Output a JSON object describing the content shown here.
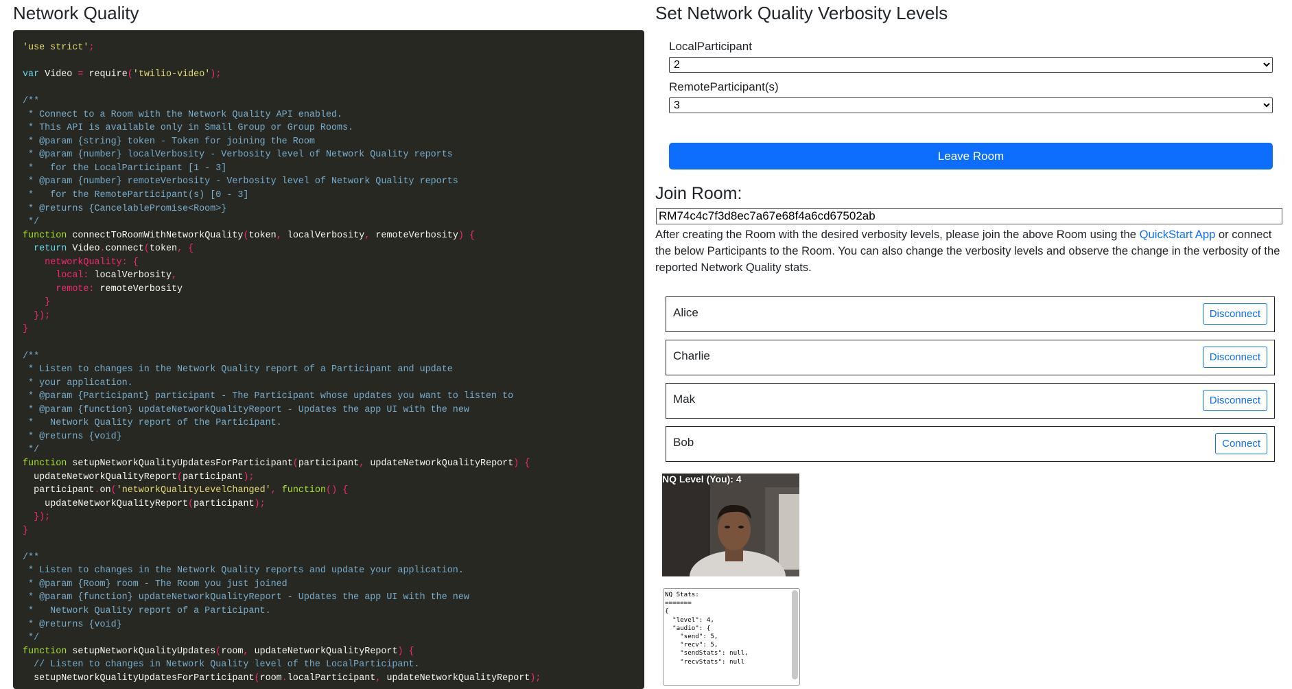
{
  "left": {
    "title": "Network Quality"
  },
  "right": {
    "title": "Set Network Quality Verbosity Levels",
    "local_label": "LocalParticipant",
    "local_value": "2",
    "remote_label": "RemoteParticipant(s)",
    "remote_value": "3",
    "leave_button": "Leave Room",
    "join_title": "Join Room:",
    "room_sid": "RM74c4c7f3d8ec7a67e68f4a6cd67502ab",
    "instructions_before": "After creating the Room with the desired verbosity levels, please join the above Room using the ",
    "quickstart_link": "QuickStart App",
    "instructions_after": " or connect the below Participants to the Room. You can also change the verbosity levels and observe the change in the verbosity of the reported Network Quality stats.",
    "participants": [
      {
        "name": "Alice",
        "action": "Disconnect"
      },
      {
        "name": "Charlie",
        "action": "Disconnect"
      },
      {
        "name": "Mak",
        "action": "Disconnect"
      },
      {
        "name": "Bob",
        "action": "Connect"
      }
    ],
    "nq_level_label": "NQ Level (You): 4",
    "nq_stats": "NQ Stats:\n=======\n{\n  \"level\": 4,\n  \"audio\": {\n    \"send\": 5,\n    \"recv\": 5,\n    \"sendStats\": null,\n    \"recvStats\": null"
  },
  "code_lines": [
    "'use strict';",
    "",
    "var Video = require('twilio-video');",
    "",
    "/**",
    " * Connect to a Room with the Network Quality API enabled.",
    " * This API is available only in Small Group or Group Rooms.",
    " * @param {string} token - Token for joining the Room",
    " * @param {number} localVerbosity - Verbosity level of Network Quality reports",
    " *   for the LocalParticipant [1 - 3]",
    " * @param {number} remoteVerbosity - Verbosity level of Network Quality reports",
    " *   for the RemoteParticipant(s) [0 - 3]",
    " * @returns {CancelablePromise<Room>}",
    " */",
    "function connectToRoomWithNetworkQuality(token, localVerbosity, remoteVerbosity) {",
    "  return Video.connect(token, {",
    "    networkQuality: {",
    "      local: localVerbosity,",
    "      remote: remoteVerbosity",
    "    }",
    "  });",
    "}",
    "",
    "/**",
    " * Listen to changes in the Network Quality report of a Participant and update",
    " * your application.",
    " * @param {Participant} participant - The Participant whose updates you want to listen to",
    " * @param {function} updateNetworkQualityReport - Updates the app UI with the new",
    " *   Network Quality report of the Participant.",
    " * @returns {void}",
    " */",
    "function setupNetworkQualityUpdatesForParticipant(participant, updateNetworkQualityReport) {",
    "  updateNetworkQualityReport(participant);",
    "  participant.on('networkQualityLevelChanged', function() {",
    "    updateNetworkQualityReport(participant);",
    "  });",
    "}",
    "",
    "/**",
    " * Listen to changes in the Network Quality reports and update your application.",
    " * @param {Room} room - The Room you just joined",
    " * @param {function} updateNetworkQualityReport - Updates the app UI with the new",
    " *   Network Quality report of a Participant.",
    " * @returns {void}",
    " */",
    "function setupNetworkQualityUpdates(room, updateNetworkQualityReport) {",
    "  // Listen to changes in Network Quality level of the LocalParticipant.",
    "  setupNetworkQualityUpdatesForParticipant(room.localParticipant, updateNetworkQualityReport);"
  ],
  "colors": {
    "code_bg": "#272822",
    "accent": "#0d6efd"
  }
}
